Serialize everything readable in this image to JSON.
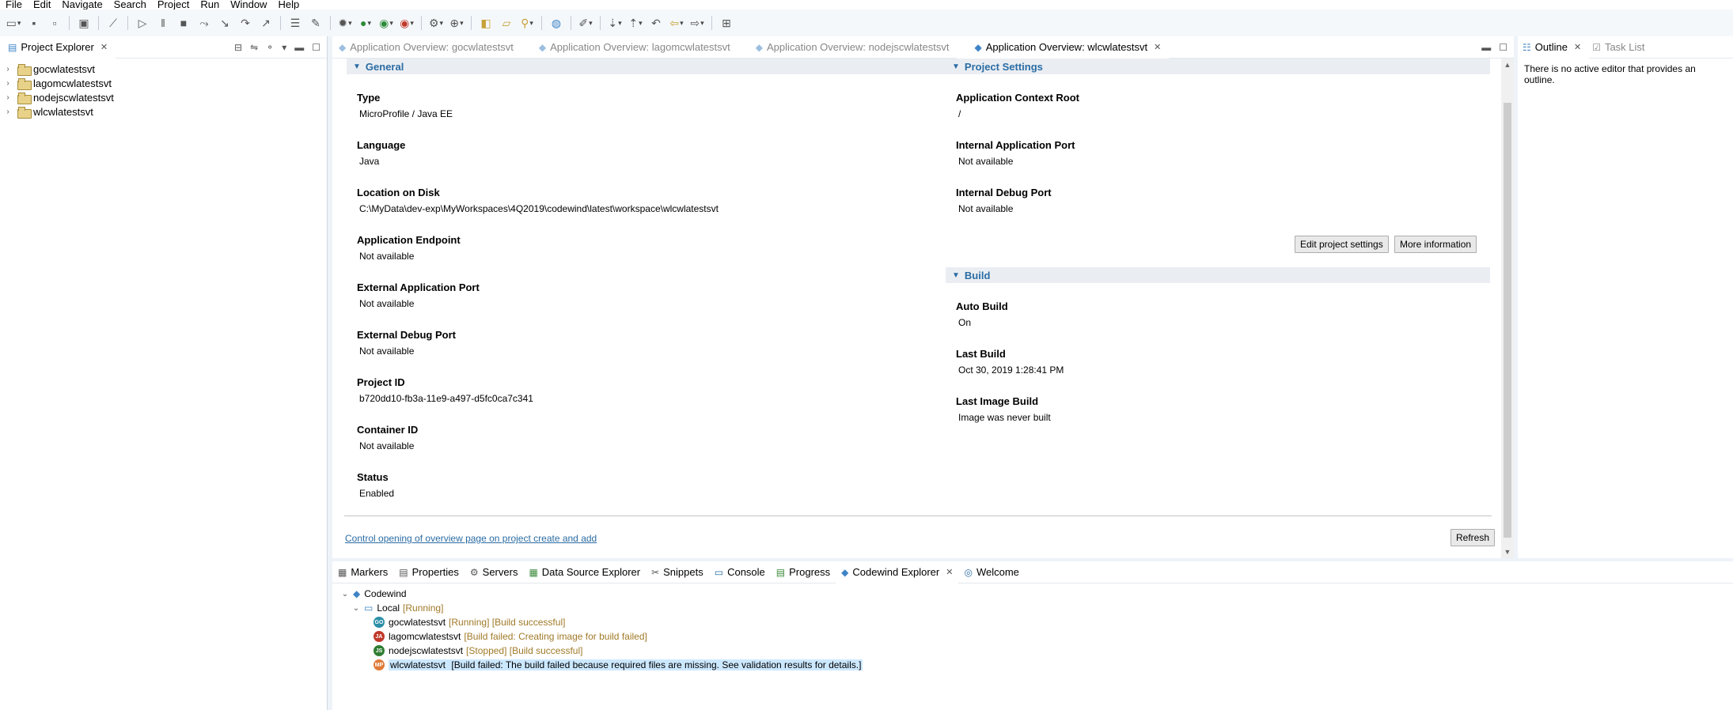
{
  "menu": [
    "File",
    "Edit",
    "Navigate",
    "Search",
    "Project",
    "Run",
    "Window",
    "Help"
  ],
  "project_explorer": {
    "title": "Project Explorer",
    "projects": [
      "gocwlatestsvt",
      "lagomcwlatestsvt",
      "nodejscwlatestsvt",
      "wlcwlatestsvt"
    ]
  },
  "editor": {
    "tabs": [
      {
        "label": "Application Overview: gocwlatestsvt",
        "active": false
      },
      {
        "label": "Application Overview: lagomcwlatestsvt",
        "active": false
      },
      {
        "label": "Application Overview: nodejscwlatestsvt",
        "active": false
      },
      {
        "label": "Application Overview: wlcwlatestsvt",
        "active": true
      }
    ],
    "general": {
      "header": "General",
      "fields": [
        {
          "label": "Type",
          "value": "MicroProfile / Java EE"
        },
        {
          "label": "Language",
          "value": "Java"
        },
        {
          "label": "Location on Disk",
          "value": "C:\\MyData\\dev-exp\\MyWorkspaces\\4Q2019\\codewind\\latest\\workspace\\wlcwlatestsvt"
        },
        {
          "label": "Application Endpoint",
          "value": "Not available"
        },
        {
          "label": "External Application Port",
          "value": "Not available"
        },
        {
          "label": "External Debug Port",
          "value": "Not available"
        },
        {
          "label": "Project ID",
          "value": "b720dd10-fb3a-11e9-a497-d5fc0ca7c341"
        },
        {
          "label": "Container ID",
          "value": "Not available"
        },
        {
          "label": "Status",
          "value": "Enabled"
        }
      ]
    },
    "project_settings": {
      "header": "Project Settings",
      "fields": [
        {
          "label": "Application Context Root",
          "value": "/"
        },
        {
          "label": "Internal Application Port",
          "value": "Not available"
        },
        {
          "label": "Internal Debug Port",
          "value": "Not available"
        }
      ],
      "edit_button": "Edit project settings",
      "more_button": "More information"
    },
    "build": {
      "header": "Build",
      "fields": [
        {
          "label": "Auto Build",
          "value": "On"
        },
        {
          "label": "Last Build",
          "value": "Oct 30, 2019 1:28:41 PM"
        },
        {
          "label": "Last Image Build",
          "value": "Image was never built"
        }
      ]
    },
    "control_link": "Control opening of overview page on project create and add",
    "refresh_button": "Refresh"
  },
  "outline": {
    "tabs": [
      "Outline",
      "Task List"
    ],
    "message": "There is no active editor that provides an outline."
  },
  "bottom": {
    "tabs": [
      "Markers",
      "Properties",
      "Servers",
      "Data Source Explorer",
      "Snippets",
      "Console",
      "Progress",
      "Codewind Explorer",
      "Welcome"
    ],
    "active_tab": "Codewind Explorer",
    "codewind": {
      "root": "Codewind",
      "local": {
        "label": "Local",
        "status": "[Running]"
      },
      "projects": [
        {
          "name": "gocwlatestsvt",
          "status": "[Running] [Build successful]",
          "badge": "GO",
          "color": "#2b8fa8"
        },
        {
          "name": "lagomcwlatestsvt",
          "status": "[Build failed: Creating image for build failed]",
          "badge": "JA",
          "color": "#c0392b"
        },
        {
          "name": "nodejscwlatestsvt",
          "status": "[Stopped] [Build successful]",
          "badge": "JS",
          "color": "#2e7d32"
        },
        {
          "name": "wlcwlatestsvt",
          "status": "[Build failed: The build failed because required files are missing. See validation results for details.]",
          "badge": "MP",
          "color": "#e07b39"
        }
      ]
    }
  }
}
